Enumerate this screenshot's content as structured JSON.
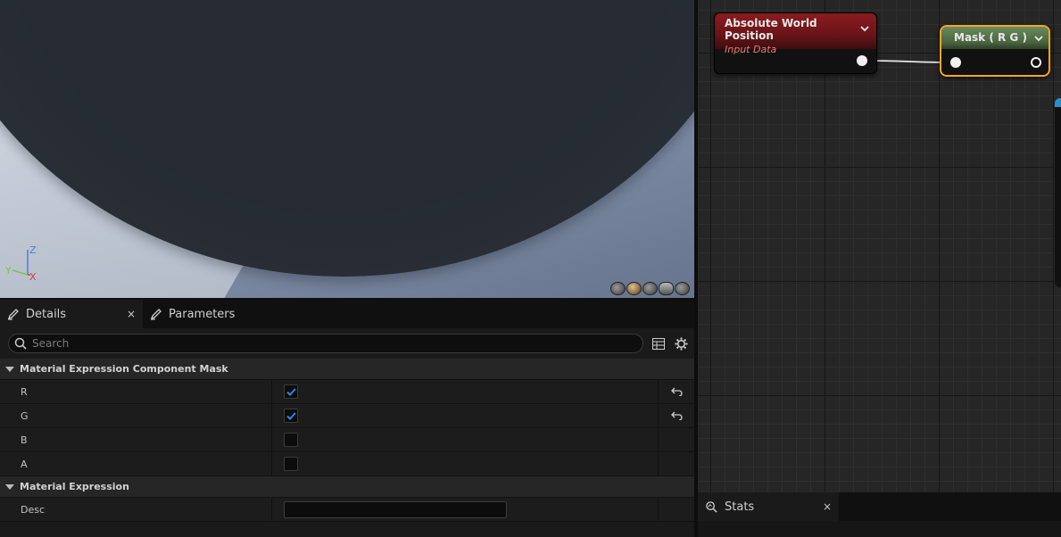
{
  "viewport": {
    "axis": {
      "z": "Z",
      "y": "Y",
      "x": "X"
    },
    "preview_buttons": [
      "cylinder-icon",
      "sphere-icon",
      "plane-icon",
      "cube-icon",
      "teapot-icon"
    ]
  },
  "details_panel": {
    "tabs": [
      {
        "label": "Details",
        "icon": "pencil-icon",
        "active": true,
        "closable": true
      },
      {
        "label": "Parameters",
        "icon": "pencil-icon",
        "active": false,
        "closable": false
      }
    ],
    "close_glyph": "×",
    "search": {
      "placeholder": "Search",
      "value": ""
    },
    "categories": [
      {
        "title": "Material Expression Component Mask",
        "rows": [
          {
            "name": "R",
            "checked": true,
            "resettable": true
          },
          {
            "name": "G",
            "checked": true,
            "resettable": true
          },
          {
            "name": "B",
            "checked": false,
            "resettable": false
          },
          {
            "name": "A",
            "checked": false,
            "resettable": false
          }
        ]
      },
      {
        "title": "Material Expression",
        "rows": [
          {
            "name": "Desc",
            "value": ""
          }
        ]
      }
    ]
  },
  "graph": {
    "nodes": [
      {
        "title": "Absolute World Position",
        "subtitle": "Input Data",
        "color": "#8a1c1f"
      },
      {
        "title": "Mask ( R G )",
        "color": "#6b8a5e",
        "selected": true,
        "selection_color": "#f5a623"
      }
    ]
  },
  "stats_panel": {
    "tab_label": "Stats",
    "close_glyph": "×"
  },
  "colors": {
    "accent_check": "#2f86e8",
    "selection": "#f5a623"
  }
}
